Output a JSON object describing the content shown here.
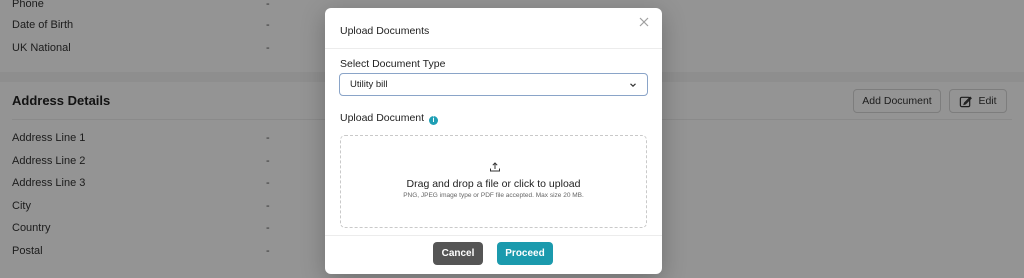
{
  "background": {
    "personal_rows": [
      {
        "label": "Phone",
        "value": "-"
      },
      {
        "label": "Date of Birth",
        "value": "-"
      },
      {
        "label": "UK National",
        "value": "-"
      }
    ],
    "address_section": {
      "title": "Address Details",
      "add_document_label": "Add Document",
      "edit_label": "Edit",
      "rows": [
        {
          "label": "Address Line 1",
          "value": "-"
        },
        {
          "label": "Address Line 2",
          "value": "-"
        },
        {
          "label": "Address Line 3",
          "value": "-"
        },
        {
          "label": "City",
          "value": "-"
        },
        {
          "label": "Country",
          "value": "-"
        },
        {
          "label": "Postal",
          "value": "-"
        }
      ]
    }
  },
  "modal": {
    "title": "Upload Documents",
    "close_icon": "close-icon",
    "document_type_label": "Select Document Type",
    "document_type_value": "Utility bill",
    "upload_label": "Upload Document",
    "dropzone": {
      "icon": "upload-icon",
      "title": "Drag and drop a file or click to upload",
      "subtitle": "PNG, JPEG image type or PDF file accepted. Max size 20 MB."
    },
    "cancel_label": "Cancel",
    "proceed_label": "Proceed"
  },
  "colors": {
    "accent": "#1b9aad",
    "cancel": "#555555",
    "info": "#1f9fb5"
  }
}
